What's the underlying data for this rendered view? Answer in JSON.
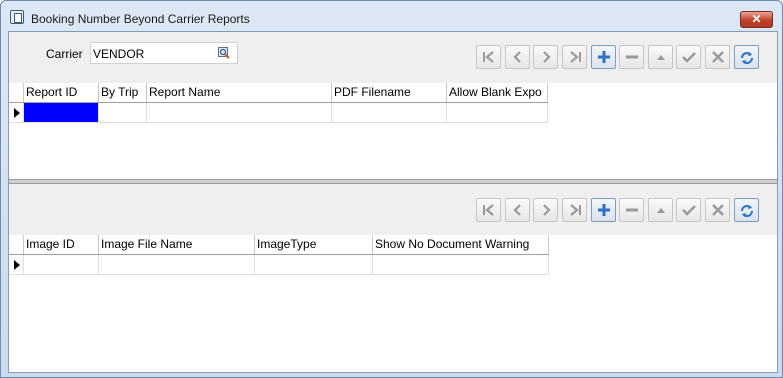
{
  "window": {
    "title": "Booking Number Beyond Carrier Reports",
    "close_label": "✕"
  },
  "carrier": {
    "label": "Carrier",
    "value": "VENDOR"
  },
  "toolbar": {
    "buttons": [
      "first",
      "prior",
      "next",
      "last",
      "insert",
      "delete",
      "edit",
      "post",
      "cancel",
      "refresh"
    ]
  },
  "reports_grid": {
    "columns": [
      "Report ID",
      "By Trip",
      "Report Name",
      "PDF Filename",
      "Allow Blank Expo"
    ],
    "rows": [
      [
        "",
        "",
        "",
        "",
        ""
      ]
    ]
  },
  "images_grid": {
    "columns": [
      "Image ID",
      "Image File Name",
      "ImageType",
      "Show No Document Warning"
    ],
    "rows": [
      [
        "",
        "",
        "",
        ""
      ]
    ]
  },
  "colors": {
    "selection": "#0000ff",
    "accent_blue": "#2f6fc8",
    "panel_bg": "#efefef"
  }
}
